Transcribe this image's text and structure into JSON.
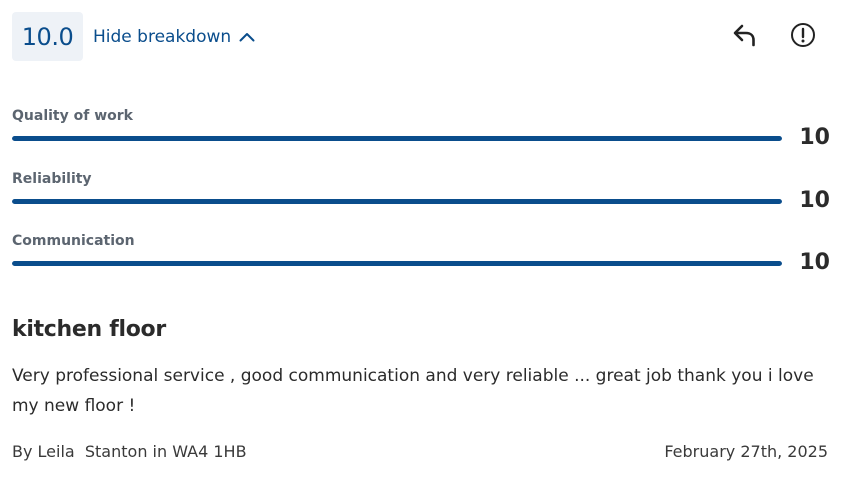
{
  "header": {
    "overall_score": "10.0",
    "toggle_label": "Hide breakdown"
  },
  "icons": {
    "toggle": "chevron-up-icon",
    "reply": "reply-arrow-icon",
    "report": "exclamation-circle-icon"
  },
  "breakdown": [
    {
      "label": "Quality of work",
      "value": "10",
      "fill": 1.0
    },
    {
      "label": "Reliability",
      "value": "10",
      "fill": 1.0
    },
    {
      "label": "Communication",
      "value": "10",
      "fill": 1.0
    }
  ],
  "review": {
    "title": "kitchen floor",
    "body": "Very professional service , good communication and very reliable ... great job thank you i love my new floor !",
    "author": "By Leila  Stanton in WA4 1HB",
    "date": "February 27th, 2025"
  },
  "colors": {
    "accent": "#0a4d8c",
    "score_bg": "#eef2f7",
    "label_gray": "#5c6570",
    "text": "#2b2b2b"
  }
}
